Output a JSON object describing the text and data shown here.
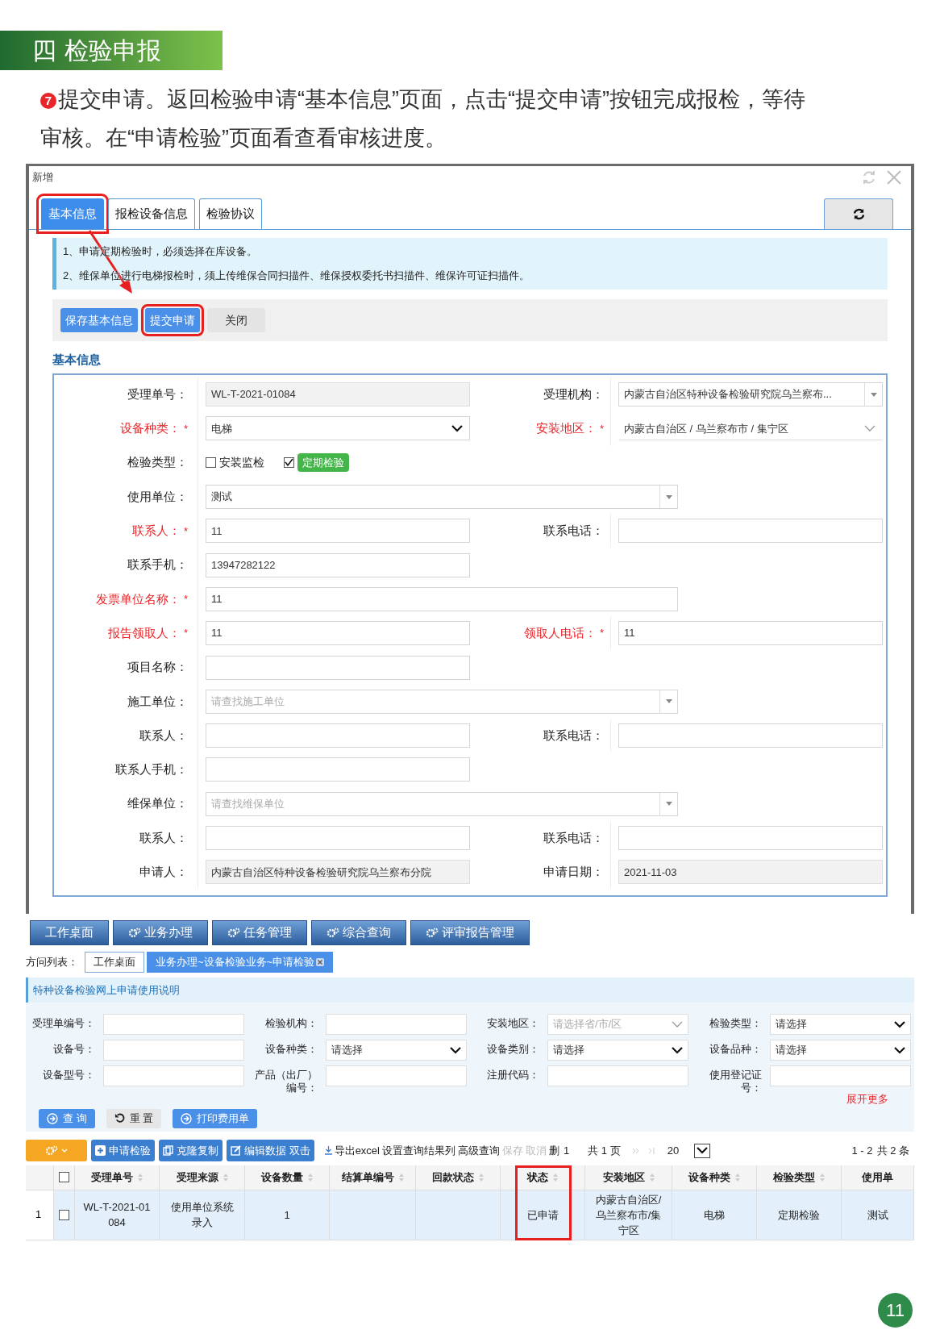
{
  "section": {
    "number": "四",
    "title": "检验申报"
  },
  "intro": {
    "step": "7",
    "text": "提交申请。返回检验申请“基本信息”页面，点击“提交申请”按钮完成报检，等待审核。在“申请检验”页面看查看审核进度。"
  },
  "dialog": {
    "title": "新增",
    "tabs": [
      {
        "label": "基本信息",
        "selected": true,
        "highlighted": true
      },
      {
        "label": "报检设备信息",
        "selected": false,
        "highlighted": false
      },
      {
        "label": "检验协议",
        "selected": false,
        "highlighted": false
      }
    ],
    "notices": [
      "1、申请定期检验时，必须选择在库设备。",
      "2、维保单位进行电梯报检时，须上传维保合同扫描件、维保授权委托书扫描件、维保许可证扫描件。"
    ],
    "buttons": [
      {
        "label": "保存基本信息",
        "primary": true,
        "highlighted": false
      },
      {
        "label": "提交申请",
        "primary": true,
        "highlighted": true
      },
      {
        "label": "关闭",
        "primary": false,
        "highlighted": false
      }
    ],
    "section_title": "基本信息",
    "rows": [
      {
        "fields": [
          {
            "label": "受理单号：",
            "kind": "readonly",
            "value": "WL-T-2021-01084"
          },
          {
            "label": "受理机构：",
            "kind": "combo",
            "value": "内蒙古自治区特种设备检验研究院乌兰察布..."
          }
        ]
      },
      {
        "fields": [
          {
            "label": "设备种类：",
            "required_mark": "*",
            "kind": "select",
            "value": "电梯"
          },
          {
            "label": "安装地区：",
            "required_mark": "*",
            "kind": "cascade",
            "value": "内蒙古自治区 / 乌兰察布市 / 集宁区"
          }
        ]
      },
      {
        "fields": [
          {
            "label": "检验类型：",
            "kind": "checks",
            "options": [
              {
                "label": "安装监检",
                "checked": false
              },
              {
                "label": "定期检验",
                "checked": true
              }
            ]
          }
        ]
      },
      {
        "fields": [
          {
            "label": "使用单位：",
            "kind": "combo",
            "wide": true,
            "value": "测试"
          }
        ]
      },
      {
        "fields": [
          {
            "label": "联系人：",
            "required_mark": "*",
            "kind": "text",
            "value": "11"
          },
          {
            "label": "联系电话：",
            "kind": "text"
          }
        ]
      },
      {
        "fields": [
          {
            "label": "联系手机：",
            "kind": "text",
            "value": "13947282122"
          }
        ]
      },
      {
        "fields": [
          {
            "label": "发票单位名称：",
            "required_mark": "*",
            "kind": "text",
            "wide": true,
            "value": "11"
          }
        ]
      },
      {
        "fields": [
          {
            "label": "报告领取人：",
            "required_mark": "*",
            "kind": "text",
            "value": "11"
          },
          {
            "label": "领取人电话：",
            "required_mark": "*",
            "kind": "text",
            "value": "11"
          }
        ]
      },
      {
        "fields": [
          {
            "label": "项目名称：",
            "kind": "text"
          }
        ]
      },
      {
        "fields": [
          {
            "label": "施工单位：",
            "kind": "combo",
            "wide": true,
            "placeholder": "请查找施工单位"
          }
        ]
      },
      {
        "fields": [
          {
            "label": "联系人：",
            "kind": "text"
          },
          {
            "label": "联系电话：",
            "kind": "text"
          }
        ]
      },
      {
        "fields": [
          {
            "label": "联系人手机：",
            "kind": "text"
          }
        ]
      },
      {
        "fields": [
          {
            "label": "维保单位：",
            "kind": "combo",
            "wide": true,
            "placeholder": "请查找维保单位"
          }
        ]
      },
      {
        "fields": [
          {
            "label": "联系人：",
            "kind": "text"
          },
          {
            "label": "联系电话：",
            "kind": "text"
          }
        ]
      },
      {
        "fields": [
          {
            "label": "申请人：",
            "kind": "readonly",
            "value": "内蒙古自治区特种设备检验研究院乌兰察布分院"
          },
          {
            "label": "申请日期：",
            "kind": "readonly",
            "value": "2021-11-03"
          }
        ]
      }
    ]
  },
  "app": {
    "nav": [
      {
        "label": "工作桌面",
        "gear": false
      },
      {
        "label": "业务办理",
        "gear": true
      },
      {
        "label": "任务管理",
        "gear": true
      },
      {
        "label": "综合查询",
        "gear": true
      },
      {
        "label": "评审报告管理",
        "gear": true
      }
    ],
    "visits": {
      "label": "方问列表：",
      "tabs": [
        {
          "label": "工作桌面",
          "selected": false,
          "closable": false
        },
        {
          "label": "业务办理~设备检验业务~申请检验",
          "selected": true,
          "closable": true
        }
      ]
    },
    "info": "特种设备检验网上申请使用说明",
    "filters": [
      {
        "label": "受理单编号：",
        "kind": "text"
      },
      {
        "label": "检验机构：",
        "kind": "text"
      },
      {
        "label": "安装地区：",
        "kind": "cascade",
        "placeholder": "请选择省/市/区"
      },
      {
        "label": "检验类型：",
        "kind": "select",
        "value": "请选择"
      },
      {
        "label": "设备号：",
        "kind": "text"
      },
      {
        "label": "设备种类：",
        "kind": "select",
        "value": "请选择"
      },
      {
        "label": "设备类别：",
        "kind": "select",
        "value": "请选择"
      },
      {
        "label": "设备品种：",
        "kind": "select",
        "value": "请选择"
      },
      {
        "label": "设备型号：",
        "kind": "text"
      },
      {
        "label": "产品（出厂）编号：",
        "kind": "text"
      },
      {
        "label": "注册代码：",
        "kind": "text"
      },
      {
        "label": "使用登记证号：",
        "kind": "text"
      }
    ],
    "more": "展开更多",
    "actions": [
      {
        "label": "查 询",
        "kind": "search"
      },
      {
        "label": "重 置",
        "kind": "reset"
      },
      {
        "label": "打印费用单",
        "kind": "print"
      }
    ],
    "toolbar": [
      {
        "label": "申请检验",
        "kind": "add"
      },
      {
        "label": "克隆复制",
        "kind": "copy"
      },
      {
        "label": "编辑数据 双击",
        "kind": "edit"
      }
    ],
    "links": [
      {
        "label": "导出excel",
        "disabled": false
      },
      {
        "label": "设置查询结果列",
        "disabled": false
      },
      {
        "label": "高级查询",
        "disabled": false
      },
      {
        "label": "保存",
        "disabled": true
      },
      {
        "label": "取消",
        "disabled": true
      },
      {
        "label": "删",
        "disabled": false
      }
    ],
    "all_checked": false,
    "pager": {
      "page": "1",
      "pages": "共 1 页",
      "size": "20",
      "range": "1 - 2",
      "total": "共 2 条"
    },
    "columns": [
      {
        "label": "受理单号",
        "sortable": true,
        "highlighted": false
      },
      {
        "label": "受理来源",
        "sortable": true,
        "highlighted": false
      },
      {
        "label": "设备数量",
        "sortable": true,
        "highlighted": false
      },
      {
        "label": "结算单编号",
        "sortable": true,
        "highlighted": false
      },
      {
        "label": "回款状态",
        "sortable": true,
        "highlighted": false
      },
      {
        "label": "状态",
        "sortable": true,
        "highlighted": true
      },
      {
        "label": "安装地区",
        "sortable": true,
        "highlighted": false
      },
      {
        "label": "设备种类",
        "sortable": true,
        "highlighted": false
      },
      {
        "label": "检验类型",
        "sortable": true,
        "highlighted": false
      },
      {
        "label": "使用单",
        "sortable": false,
        "highlighted": false
      }
    ],
    "rows": [
      {
        "index": "1",
        "checked": false,
        "selected": true,
        "cells": [
          "WL-T-2021-01084",
          "使用单位系统录入",
          "1",
          null,
          null,
          "已申请",
          "内蒙古自治区/乌兰察布市/集宁区",
          "电梯",
          "定期检验",
          "测试"
        ]
      }
    ]
  },
  "page_number": "11"
}
